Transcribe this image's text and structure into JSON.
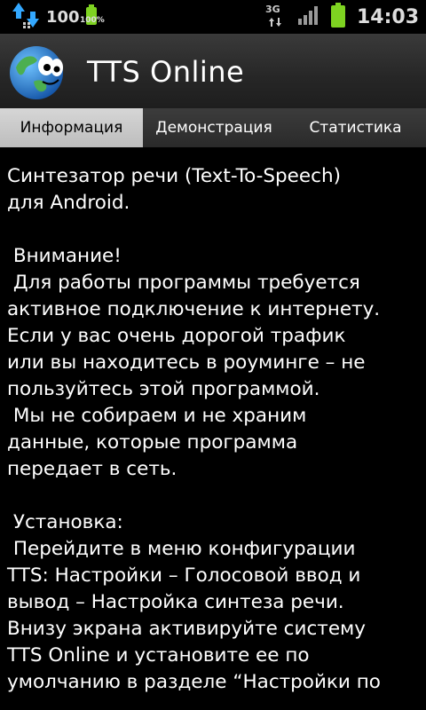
{
  "status_bar": {
    "notification_count": "100",
    "battery_small_label": "100%",
    "network_type": "3G",
    "time": "14:03"
  },
  "app": {
    "title": "TTS Online",
    "icon": "globe-mascot-icon"
  },
  "tabs": [
    {
      "label": "Информация",
      "selected": true
    },
    {
      "label": "Демонстрация",
      "selected": false
    },
    {
      "label": "Статистика",
      "selected": false
    }
  ],
  "content": {
    "p1": "Синтезатор речи (Text-To-Speech)\nдля Android.",
    "p2": " Внимание!\n Для работы программы требуется\nактивное подключение к интернету.\nЕсли у вас очень дорогой трафик\nили вы находитесь в роуминге – не\nпользуйтесь этой программой.\n Мы не собираем и не храним\nданные, которые программа\nпередает в сеть.",
    "p3": " Установка:\n Перейдите в меню конфигурации\nTTS: Настройки – Голосовой ввод и\nвывод – Настройка синтеза речи.\nВнизу экрана активируйте систему\nTTS Online и установите ее по\nумолчанию в разделе “Настройки по"
  },
  "colors": {
    "background": "#000000",
    "selected_tab": "#cfcfcf",
    "battery_green": "#7ed321"
  }
}
